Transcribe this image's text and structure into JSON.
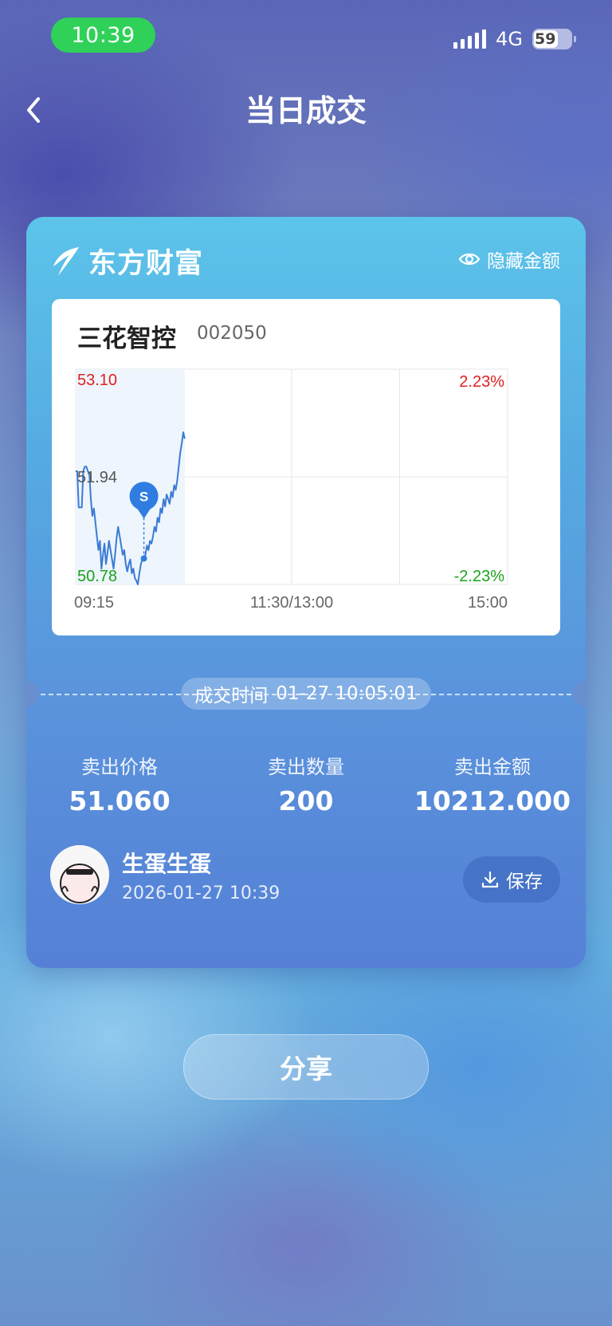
{
  "status_bar": {
    "time": "10:39",
    "network": "4G",
    "battery": "59"
  },
  "nav": {
    "back_icon": "chevron-left-icon",
    "title": "当日成交"
  },
  "card": {
    "brand": "东方财富",
    "hide_amount": "隐藏金额",
    "stock": {
      "name": "三花智控",
      "code": "002050"
    },
    "deal_time_label": "成交时间",
    "deal_time_value": "01-27 10:05:01",
    "stats": [
      {
        "label": "卖出价格",
        "value": "51.060"
      },
      {
        "label": "卖出数量",
        "value": "200"
      },
      {
        "label": "卖出金额",
        "value": "10212.000"
      }
    ],
    "user": {
      "name": "生蛋生蛋",
      "time": "2026-01-27 10:39"
    },
    "save_label": "保存"
  },
  "share_label": "分享",
  "chart_data": {
    "type": "line",
    "y_left_ticks": [
      "53.10",
      "51.94",
      "50.78"
    ],
    "y_right_ticks": [
      "2.23%",
      "-2.23%"
    ],
    "x_ticks": [
      "09:15",
      "11:30/13:00",
      "15:00"
    ],
    "ylim": [
      50.78,
      53.1
    ],
    "colors": {
      "up": "#e02020",
      "down": "#1aa31a",
      "line": "#3a7bd5",
      "marker": "#2f7de1"
    },
    "marker": {
      "label": "S",
      "x": 45,
      "y": 51.06
    },
    "series": [
      {
        "values": [
          [
            0,
            52.0
          ],
          [
            1,
            52.0
          ],
          [
            2,
            51.61
          ],
          [
            3,
            51.61
          ],
          [
            4,
            51.61
          ],
          [
            5,
            52.0
          ],
          [
            6,
            52.05
          ],
          [
            7,
            52.05
          ],
          [
            8,
            52.0
          ],
          [
            9,
            51.98
          ],
          [
            10,
            51.7
          ],
          [
            11,
            51.52
          ],
          [
            12,
            51.6
          ],
          [
            13,
            51.45
          ],
          [
            14,
            51.3
          ],
          [
            15,
            51.15
          ],
          [
            16,
            51.25
          ],
          [
            17,
            50.95
          ],
          [
            18,
            51.1
          ],
          [
            19,
            51.22
          ],
          [
            20,
            51.0
          ],
          [
            21,
            51.12
          ],
          [
            22,
            51.25
          ],
          [
            23,
            51.15
          ],
          [
            24,
            51.05
          ],
          [
            25,
            50.95
          ],
          [
            26,
            51.1
          ],
          [
            27,
            51.28
          ],
          [
            28,
            51.4
          ],
          [
            29,
            51.3
          ],
          [
            30,
            51.2
          ],
          [
            31,
            51.1
          ],
          [
            32,
            51.15
          ],
          [
            33,
            51.0
          ],
          [
            34,
            50.92
          ],
          [
            35,
            51.0
          ],
          [
            36,
            51.05
          ],
          [
            37,
            50.9
          ],
          [
            38,
            50.95
          ],
          [
            39,
            50.85
          ],
          [
            40,
            50.82
          ],
          [
            41,
            50.78
          ],
          [
            42,
            50.9
          ],
          [
            43,
            51.0
          ],
          [
            44,
            51.05
          ],
          [
            45,
            51.06
          ],
          [
            46,
            51.1
          ],
          [
            47,
            51.2
          ],
          [
            48,
            51.15
          ],
          [
            49,
            51.25
          ],
          [
            50,
            51.22
          ],
          [
            51,
            51.3
          ],
          [
            52,
            51.4
          ],
          [
            53,
            51.35
          ],
          [
            54,
            51.5
          ],
          [
            55,
            51.45
          ],
          [
            56,
            51.6
          ],
          [
            57,
            51.55
          ],
          [
            58,
            51.7
          ],
          [
            59,
            51.62
          ],
          [
            60,
            51.75
          ],
          [
            61,
            51.7
          ],
          [
            62,
            51.65
          ],
          [
            63,
            51.78
          ],
          [
            64,
            51.72
          ],
          [
            65,
            51.85
          ],
          [
            66,
            51.8
          ],
          [
            67,
            51.9
          ],
          [
            68,
            52.05
          ],
          [
            69,
            52.2
          ],
          [
            70,
            52.3
          ],
          [
            71,
            52.42
          ],
          [
            72,
            52.35
          ]
        ]
      }
    ]
  }
}
